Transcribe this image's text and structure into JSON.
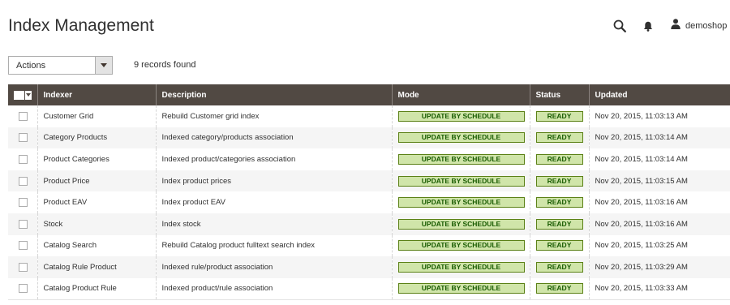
{
  "page": {
    "title": "Index Management"
  },
  "header": {
    "user_name": "demoshop"
  },
  "toolbar": {
    "actions_label": "Actions",
    "records_found": "9 records found"
  },
  "grid": {
    "columns": {
      "indexer": "Indexer",
      "description": "Description",
      "mode": "Mode",
      "status": "Status",
      "updated": "Updated"
    },
    "rows": [
      {
        "indexer": "Customer Grid",
        "description": "Rebuild Customer grid index",
        "mode": "UPDATE BY SCHEDULE",
        "status": "READY",
        "updated": "Nov 20, 2015, 11:03:13 AM"
      },
      {
        "indexer": "Category Products",
        "description": "Indexed category/products association",
        "mode": "UPDATE BY SCHEDULE",
        "status": "READY",
        "updated": "Nov 20, 2015, 11:03:14 AM"
      },
      {
        "indexer": "Product Categories",
        "description": "Indexed product/categories association",
        "mode": "UPDATE BY SCHEDULE",
        "status": "READY",
        "updated": "Nov 20, 2015, 11:03:14 AM"
      },
      {
        "indexer": "Product Price",
        "description": "Index product prices",
        "mode": "UPDATE BY SCHEDULE",
        "status": "READY",
        "updated": "Nov 20, 2015, 11:03:15 AM"
      },
      {
        "indexer": "Product EAV",
        "description": "Index product EAV",
        "mode": "UPDATE BY SCHEDULE",
        "status": "READY",
        "updated": "Nov 20, 2015, 11:03:16 AM"
      },
      {
        "indexer": "Stock",
        "description": "Index stock",
        "mode": "UPDATE BY SCHEDULE",
        "status": "READY",
        "updated": "Nov 20, 2015, 11:03:16 AM"
      },
      {
        "indexer": "Catalog Search",
        "description": "Rebuild Catalog product fulltext search index",
        "mode": "UPDATE BY SCHEDULE",
        "status": "READY",
        "updated": "Nov 20, 2015, 11:03:25 AM"
      },
      {
        "indexer": "Catalog Rule Product",
        "description": "Indexed rule/product association",
        "mode": "UPDATE BY SCHEDULE",
        "status": "READY",
        "updated": "Nov 20, 2015, 11:03:29 AM"
      },
      {
        "indexer": "Catalog Product Rule",
        "description": "Indexed product/rule association",
        "mode": "UPDATE BY SCHEDULE",
        "status": "READY",
        "updated": "Nov 20, 2015, 11:03:33 AM"
      }
    ]
  },
  "colors": {
    "header_bg": "#514943",
    "badge_bg": "#d0e5a9",
    "badge_border": "#5b8116",
    "badge_text": "#185b00"
  },
  "icons": {
    "search": "search-icon",
    "notifications": "bell-icon",
    "user": "user-icon",
    "dropdown": "chevron-down-icon"
  }
}
